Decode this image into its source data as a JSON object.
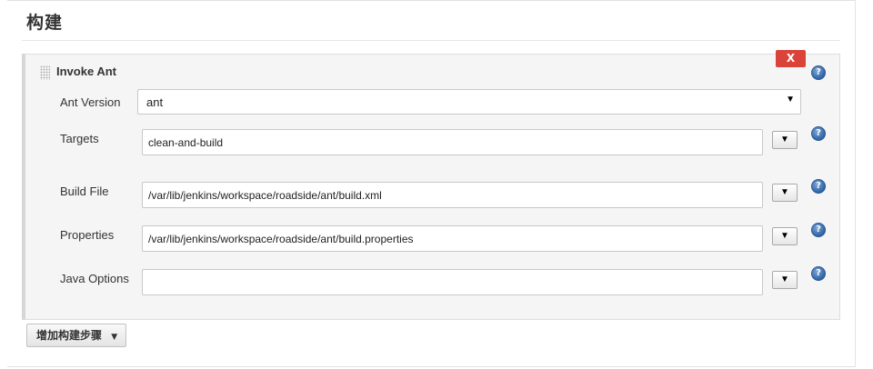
{
  "section": {
    "title": "构建"
  },
  "step": {
    "title": "Invoke Ant",
    "delete_label": "X",
    "help_glyph": "?"
  },
  "fields": {
    "ant_version": {
      "label": "Ant Version",
      "value": "ant",
      "arrow": "▼"
    },
    "targets": {
      "label": "Targets",
      "value": "clean-and-build"
    },
    "build_file": {
      "label": "Build File",
      "value": "/var/lib/jenkins/workspace/roadside/ant/build.xml"
    },
    "properties": {
      "label": "Properties",
      "value": "/var/lib/jenkins/workspace/roadside/ant/build.properties"
    },
    "java_options": {
      "label": "Java Options",
      "value": ""
    },
    "expand_glyph": "▼"
  },
  "add_step": {
    "label": "增加构建步骤",
    "caret": "▼"
  },
  "colors": {
    "delete": "#d9433a",
    "help": "#2f64a6"
  },
  "icons": {
    "help": "help-icon",
    "drag": "drag-handle-icon",
    "expand": "chevron-down-icon"
  }
}
